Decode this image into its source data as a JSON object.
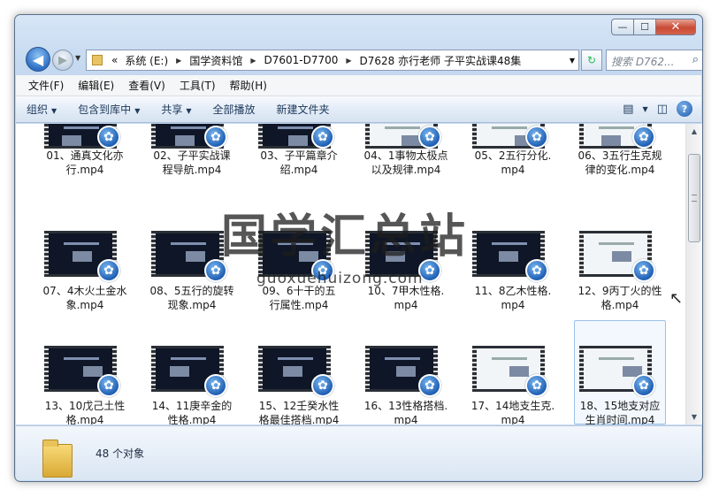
{
  "window": {
    "min_icon": "minimize-icon",
    "max_icon": "maximize-icon",
    "close_icon": "close-icon",
    "min_glyph": "—",
    "max_glyph": "☐",
    "close_glyph": "✕"
  },
  "nav": {
    "back_glyph": "◀",
    "fwd_glyph": "▶",
    "dd_glyph": "▼",
    "breadcrumb": [
      "«",
      "系统 (E:)",
      "国学资料馆",
      "D7601-D7700",
      "D7628 亦行老师 子平实战课48集"
    ],
    "search_placeholder": "搜索 D762...",
    "refresh_glyph": "↻",
    "search_glyph": "⌕"
  },
  "menu": [
    "文件(F)",
    "编辑(E)",
    "查看(V)",
    "工具(T)",
    "帮助(H)"
  ],
  "toolbar": {
    "organize": "组织",
    "include": "包含到库中",
    "share": "共享",
    "playall": "全部播放",
    "newfolder": "新建文件夹",
    "dd": "▼",
    "help": "?",
    "view_glyph": "▤",
    "pane_glyph": "◫"
  },
  "files": [
    {
      "l1": "01、通真文化亦",
      "l2": "行.mp4"
    },
    {
      "l1": "02、子平实战课",
      "l2": "程导航.mp4"
    },
    {
      "l1": "03、子平篇章介",
      "l2": "绍.mp4"
    },
    {
      "l1": "04、1事物太极点",
      "l2": "以及规律.mp4"
    },
    {
      "l1": "05、2五行分化.",
      "l2": "mp4"
    },
    {
      "l1": "06、3五行生克规",
      "l2": "律的变化.mp4"
    },
    {
      "l1": "07、4木火土金水",
      "l2": "象.mp4"
    },
    {
      "l1": "08、5五行的旋转",
      "l2": "现象.mp4"
    },
    {
      "l1": "09、6十干的五",
      "l2": "行属性.mp4"
    },
    {
      "l1": "10、7甲木性格.",
      "l2": "mp4"
    },
    {
      "l1": "11、8乙木性格.",
      "l2": "mp4"
    },
    {
      "l1": "12、9丙丁火的性",
      "l2": "格.mp4"
    },
    {
      "l1": "13、10戊己土性",
      "l2": "格.mp4"
    },
    {
      "l1": "14、11庚辛金的",
      "l2": "性格.mp4"
    },
    {
      "l1": "15、12壬癸水性",
      "l2": "格最佳搭档.mp4"
    },
    {
      "l1": "16、13性格搭档.",
      "l2": "mp4"
    },
    {
      "l1": "17、14地支生克.",
      "l2": "mp4"
    },
    {
      "l1": "18、15地支对应",
      "l2": "生肖时间.mp4"
    }
  ],
  "badge_glyph": "✿",
  "watermark": "国学汇总站",
  "watermark_url": "guoxuehuizong.com",
  "status": {
    "count": "48 个对象"
  }
}
